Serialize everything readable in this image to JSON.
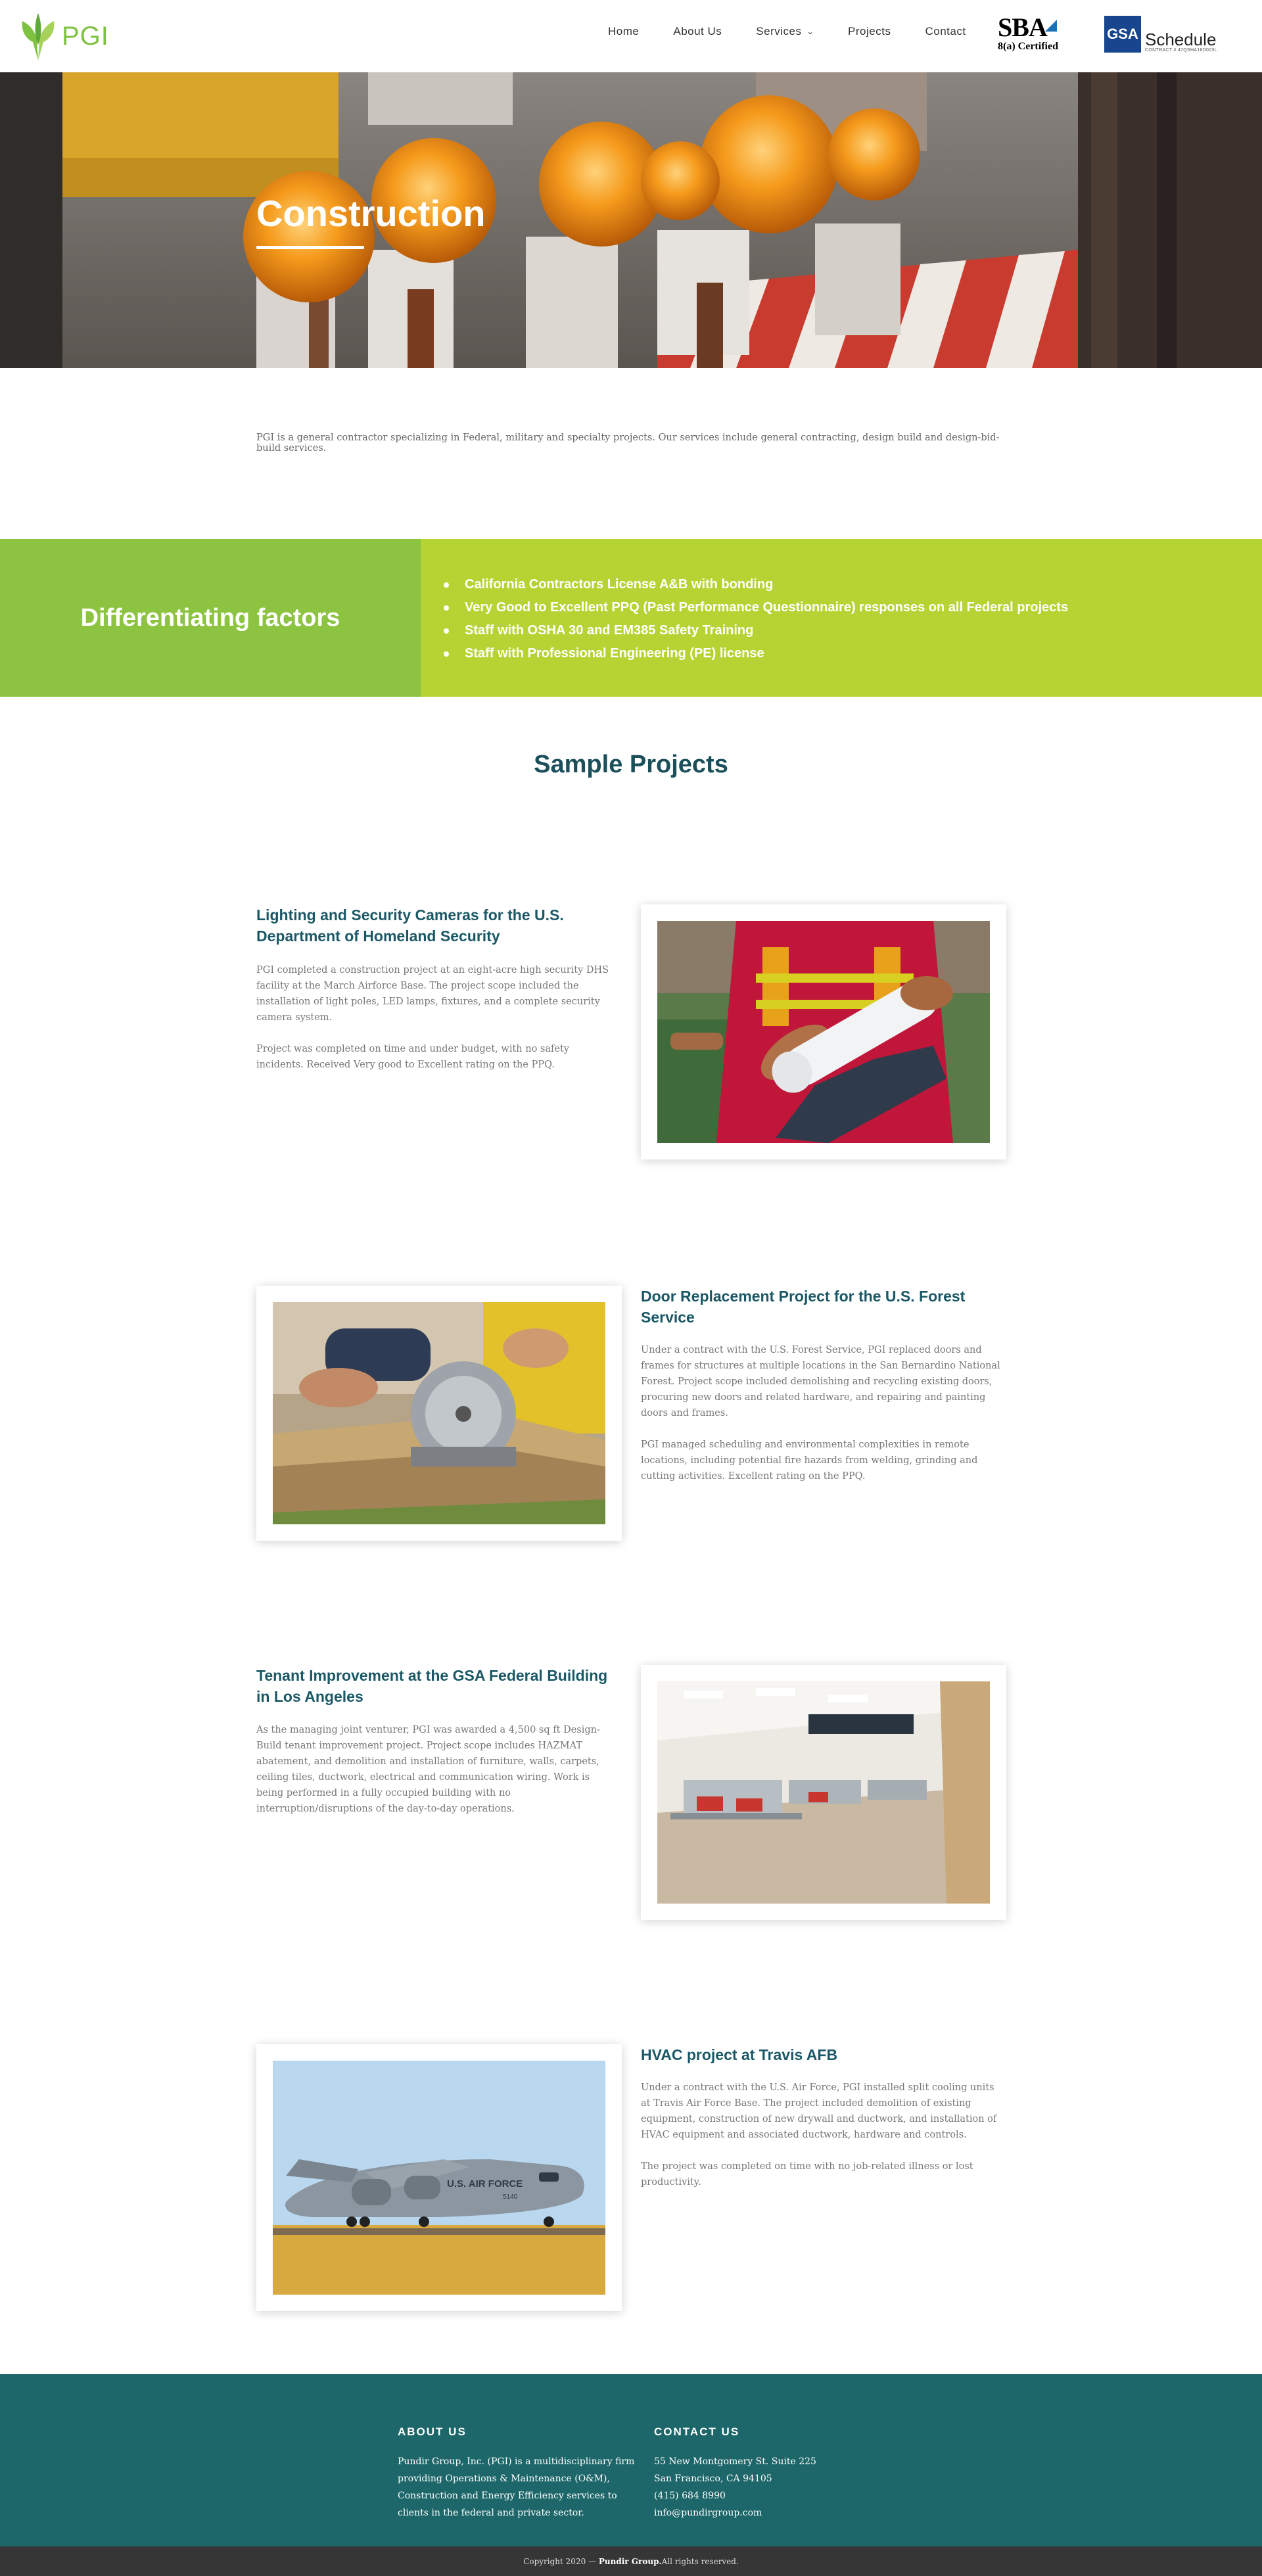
{
  "header": {
    "logo_text": "PGI",
    "nav": [
      {
        "label": "Home"
      },
      {
        "label": "About Us"
      },
      {
        "label": "Services",
        "has_dropdown": true
      },
      {
        "label": "Projects"
      },
      {
        "label": "Contact"
      }
    ],
    "sba": {
      "line1": "SBA",
      "line2": "8(a) Certified"
    },
    "gsa": {
      "box": "GSA",
      "text": "Schedule",
      "sub": "CONTRACT # 47QSHA18D003L"
    }
  },
  "hero": {
    "title": "Construction"
  },
  "intro": "PGI is a general contractor specializing in Federal, military and specialty projects. Our services include general contracting, design build and design-bid-build services.",
  "differentiating": {
    "title": "Differentiating factors",
    "items": [
      "California Contractors License A&B with bonding",
      "Very Good to Excellent PPQ (Past Performance Questionnaire) responses on all Federal projects",
      "Staff with OSHA 30 and EM385 Safety Training",
      "Staff with Professional Engineering (PE) license"
    ]
  },
  "sample_projects": {
    "title": "Sample Projects",
    "projects": [
      {
        "title": "Lighting and Security Cameras for the U.S. Department of Homeland Security",
        "p1": "PGI completed a construction project at an eight-acre high security DHS facility at the March Airforce Base. The project scope included the installation of light poles, LED lamps, fixtures, and a complete security camera system.",
        "p2": "Project was completed on time and under budget, with no safety incidents. Received Very good to Excellent rating on the PPQ."
      },
      {
        "title": "Door Replacement Project for the U.S. Forest Service",
        "p1": "Under a contract with the U.S. Forest Service, PGI replaced doors and frames for structures at multiple locations in the San Bernardino National Forest. Project scope included demolishing and recycling existing doors, procuring new doors and related hardware, and repairing and painting doors and frames.",
        "p2": "PGI managed scheduling and environmental complexities in remote locations, including potential fire hazards from welding, grinding and cutting activities. Excellent rating on the PPQ."
      },
      {
        "title": "Tenant Improvement at the GSA Federal Building in Los Angeles",
        "p1": "As the managing joint venturer, PGI was awarded a 4,500 sq ft Design-Build tenant improvement project. Project scope includes HAZMAT abatement, and demolition and installation of furniture, walls, carpets, ceiling tiles, ductwork, electrical and communication wiring. Work is being performed in a fully occupied building with no interruption/disruptions of the day-to-day operations.",
        "p2": ""
      },
      {
        "title": "HVAC project at Travis AFB",
        "p1": "Under a contract with the U.S. Air Force, PGI installed split cooling units at Travis Air Force Base. The project included demolition of existing equipment, construction of new drywall and ductwork, and installation of HVAC equipment and associated ductwork, hardware and controls.",
        "p2": "The project was completed on time with no job-related illness or lost productivity.",
        "plane_text": "U.S. AIR FORCE",
        "plane_tail": "5140"
      }
    ]
  },
  "footer": {
    "about_heading": "ABOUT US",
    "about_lines": [
      "Pundir Group, Inc. (PGI) is a multidisciplinary firm",
      "providing Operations & Maintenance (O&M),",
      "Construction and Energy Efficiency services to",
      "clients in the federal and private sector."
    ],
    "contact_heading": "CONTACT US",
    "contact_lines": [
      "55 New Montgomery St. Suite 225",
      "San Francisco, CA 94105",
      "(415) 684 8990",
      "info@pundirgroup.com"
    ],
    "copyright_prefix": "Copyright 2020 — ",
    "copyright_brand": "Pundir Group.",
    "copyright_suffix": " All rights reserved."
  },
  "colors": {
    "brand_green": "#7fc241",
    "diff_left": "#8cc340",
    "diff_right": "#b6d334",
    "heading_teal": "#1b4f5a",
    "footer_teal": "#1d6669",
    "copyright_bg": "#363636"
  }
}
